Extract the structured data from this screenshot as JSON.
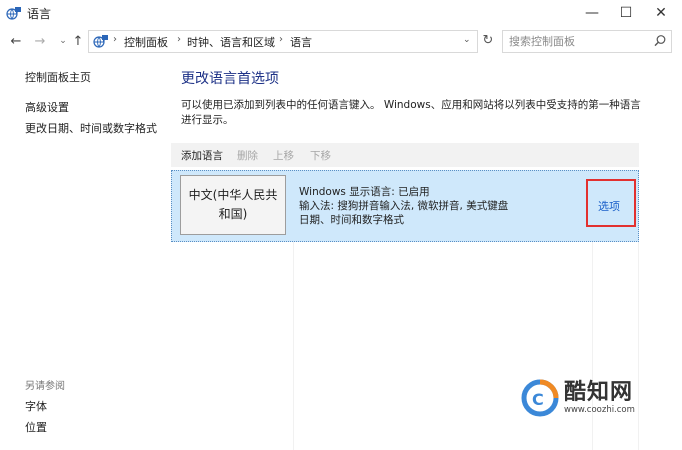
{
  "window": {
    "title": "语言",
    "controls": {
      "minimize": "—",
      "maximize": "☐",
      "close": "✕"
    }
  },
  "nav": {
    "back": "←",
    "forward": "→",
    "history": "⌄",
    "up": "↑",
    "breadcrumbs": [
      "控制面板",
      "时钟、语言和区域",
      "语言"
    ],
    "crumb_separator": "›",
    "dropdown": "⌄",
    "refresh": "↻",
    "search_placeholder": "搜索控制面板"
  },
  "sidebar": {
    "home": "控制面板主页",
    "links": [
      "高级设置",
      "更改日期、时间或数字格式"
    ],
    "see_also_heading": "另请参阅",
    "see_also": [
      "字体",
      "位置"
    ]
  },
  "main": {
    "title": "更改语言首选项",
    "description": "可以使用已添加到列表中的任何语言键入。 Windows、应用和网站将以列表中受支持的第一种语言进行显示。",
    "toolbar": {
      "add": "添加语言",
      "remove": "删除",
      "move_up": "上移",
      "move_down": "下移"
    },
    "languages": [
      {
        "name": "中文(中华人民共和国)",
        "display_language": "Windows 显示语言: 已启用",
        "input_methods": "输入法: 搜狗拼音输入法, 微软拼音, 美式键盘",
        "formats": "日期、时间和数字格式",
        "options": "选项"
      }
    ]
  },
  "watermark": {
    "brand": "酷知网",
    "url": "www.coozhi.com"
  },
  "colors": {
    "title_blue": "#1e3287",
    "link_blue": "#1a5fc9",
    "row_selected": "#cfe8fb",
    "highlight_red": "#e2302f"
  }
}
